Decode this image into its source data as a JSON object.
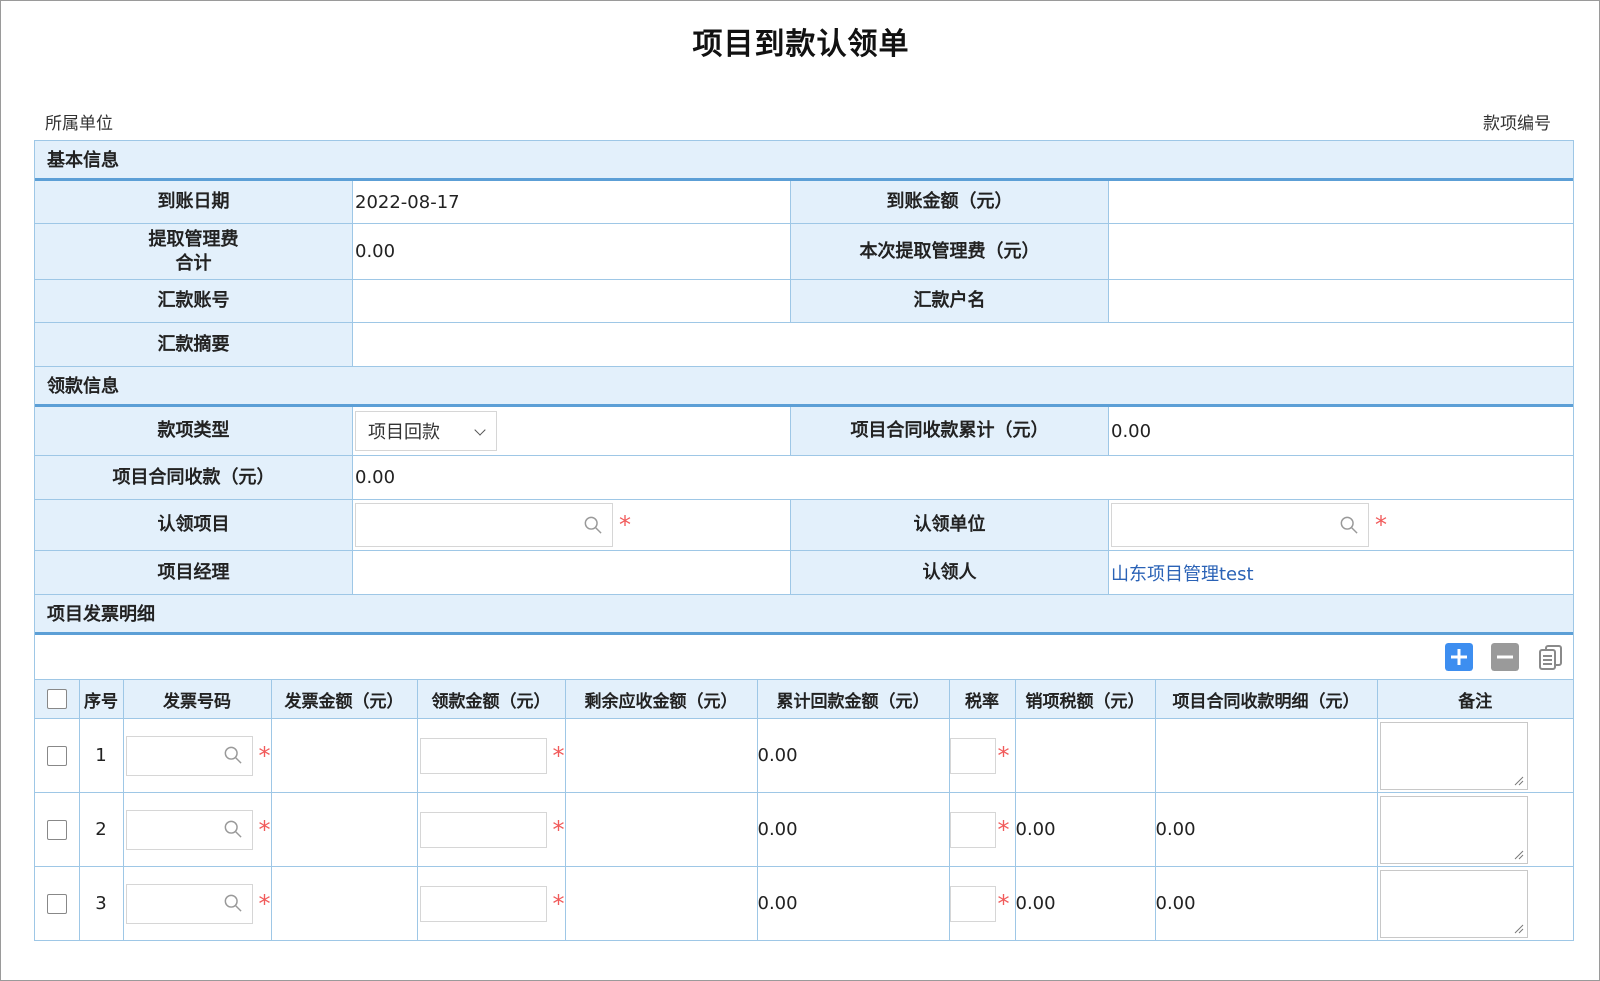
{
  "title": "项目到款认领单",
  "meta": {
    "unit_label": "所属单位",
    "code_label": "款项编号"
  },
  "sections": {
    "basic": "基本信息",
    "claim": "领款信息",
    "invoice": "项目发票明细"
  },
  "basic": {
    "arrival_date_label": "到账日期",
    "arrival_date_value": "2022-08-17",
    "arrival_amount_label": "到账金额（元）",
    "arrival_amount_value": "",
    "mgmt_fee_total_label_1": "提取管理费",
    "mgmt_fee_total_label_2": "合计",
    "mgmt_fee_total_value": "0.00",
    "mgmt_fee_this_label": "本次提取管理费（元）",
    "mgmt_fee_this_value": "",
    "account_no_label": "汇款账号",
    "account_no_value": "",
    "account_name_label": "汇款户名",
    "account_name_value": "",
    "summary_label": "汇款摘要",
    "summary_value": ""
  },
  "claim": {
    "fund_type_label": "款项类型",
    "fund_type_value": "项目回款",
    "contract_cum_label": "项目合同收款累计（元）",
    "contract_cum_value": "0.00",
    "contract_recv_label": "项目合同收款（元）",
    "contract_recv_value": "0.00",
    "project_label": "认领项目",
    "unit_label": "认领单位",
    "manager_label": "项目经理",
    "manager_value": "",
    "claimant_label": "认领人",
    "claimant_value": "山东项目管理test"
  },
  "invoice": {
    "columns": [
      "序号",
      "发票号码",
      "发票金额（元）",
      "领款金额（元）",
      "剩余应收金额（元）",
      "累计回款金额（元）",
      "税率",
      "销项税额（元）",
      "项目合同收款明细（元）",
      "备注"
    ],
    "rows": [
      {
        "no": "1",
        "cum_return": "0.00",
        "output_tax": "",
        "contract_detail": ""
      },
      {
        "no": "2",
        "cum_return": "0.00",
        "output_tax": "0.00",
        "contract_detail": "0.00"
      },
      {
        "no": "3",
        "cum_return": "0.00",
        "output_tax": "0.00",
        "contract_detail": "0.00"
      }
    ]
  },
  "icons": {
    "add": "plus-icon",
    "remove": "minus-icon",
    "copy": "copy-icon",
    "search": "search-icon"
  },
  "colors": {
    "header_bg": "#e3f0fb",
    "accent": "#5c9fd6",
    "required": "#f15b5b",
    "link": "#2a62b6",
    "add_button": "#3d8ef0"
  }
}
